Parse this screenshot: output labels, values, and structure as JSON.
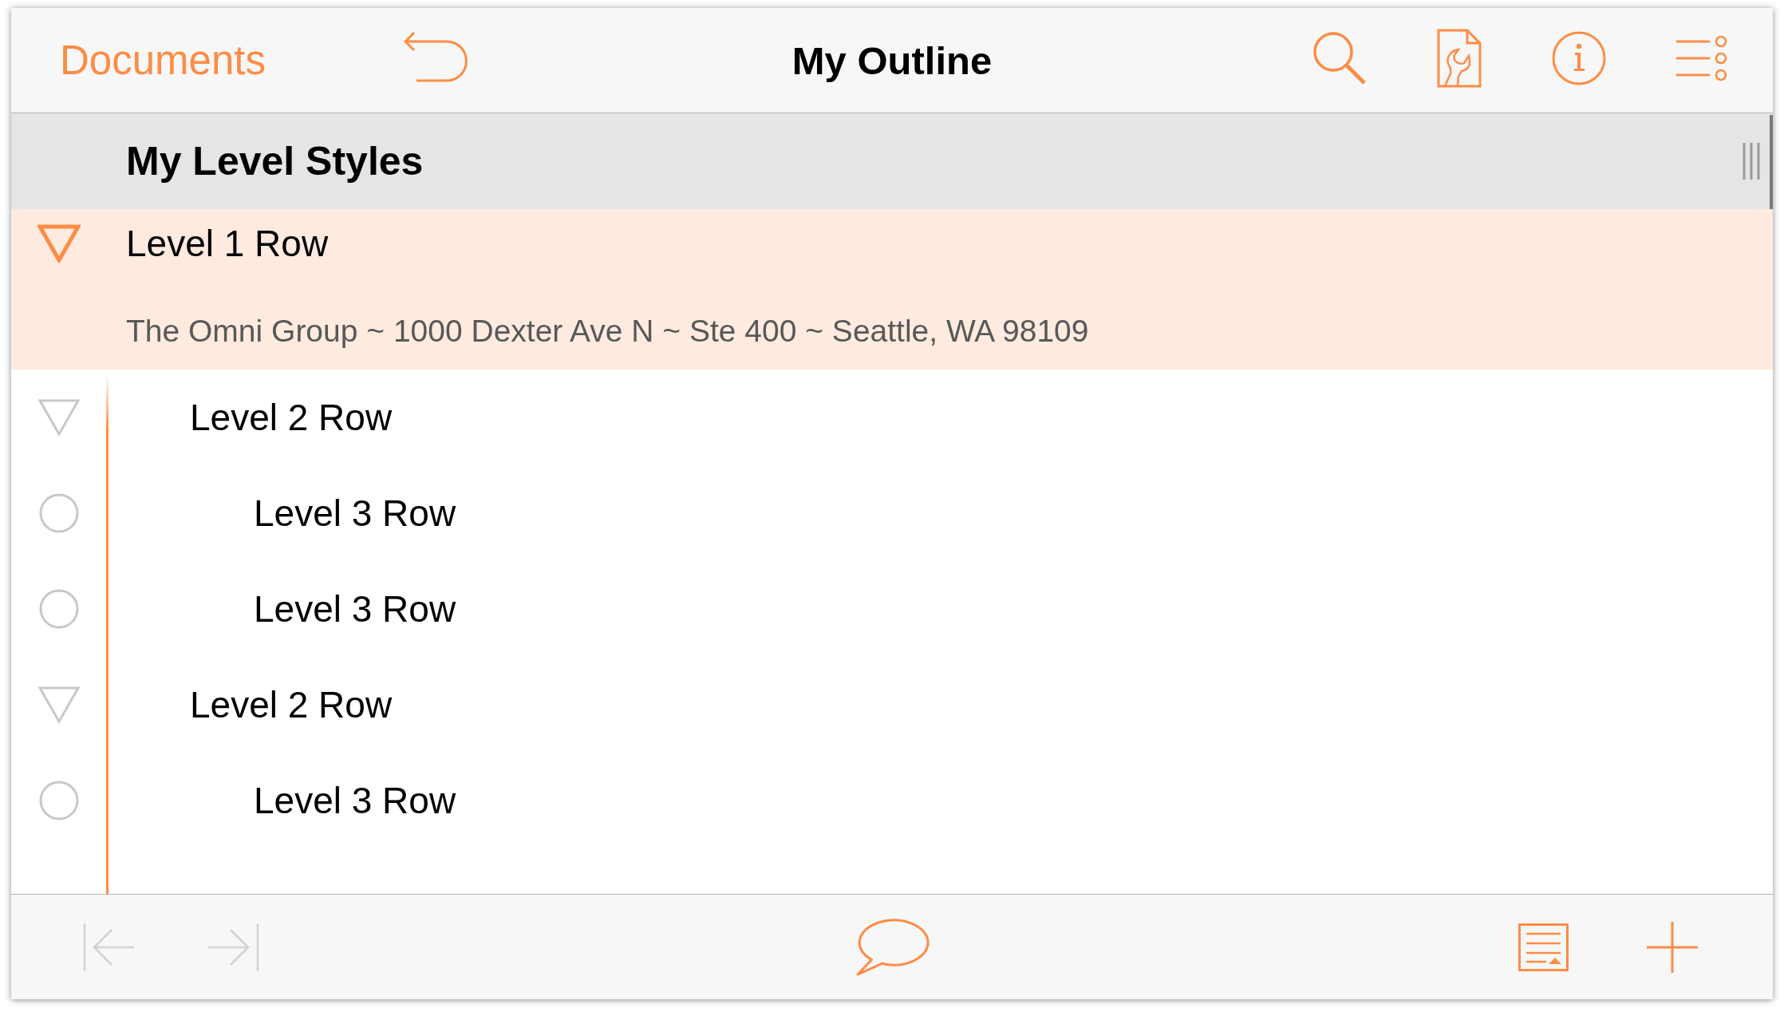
{
  "toolbar": {
    "back_label": "Documents",
    "title": "My Outline"
  },
  "outline_header": {
    "title": "My Level Styles"
  },
  "outline": [
    {
      "title": "Level 1 Row",
      "note": "The Omni Group ~ 1000 Dexter Ave N ~ Ste 400 ~ Seattle, WA 98109",
      "selected": true,
      "expanded": true,
      "children": [
        {
          "title": "Level 2 Row",
          "selected": false,
          "expanded": true,
          "children": [
            {
              "title": "Level 3 Row",
              "selected": false
            },
            {
              "title": "Level 3 Row",
              "selected": false
            }
          ]
        },
        {
          "title": "Level 2 Row",
          "selected": false,
          "expanded": true,
          "children": [
            {
              "title": "Level 3 Row",
              "selected": false
            }
          ]
        }
      ]
    }
  ],
  "bottom_toolbar": {
    "left": [
      {
        "kind": "outdent",
        "disabled": true
      },
      {
        "kind": "indent",
        "disabled": true
      }
    ],
    "center": [
      {
        "kind": "comment",
        "disabled": false
      }
    ],
    "right": [
      {
        "kind": "notes",
        "disabled": false
      },
      {
        "kind": "add",
        "disabled": false
      }
    ]
  }
}
